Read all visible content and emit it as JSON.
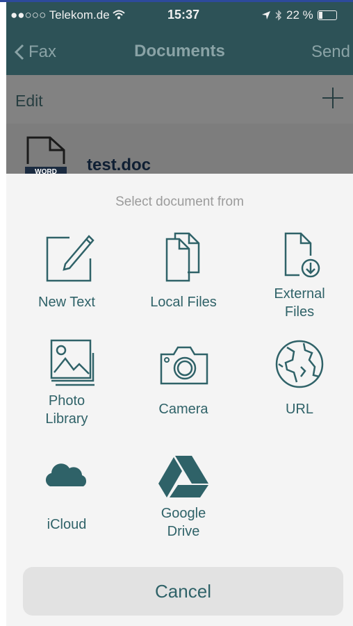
{
  "status": {
    "carrier": "●●○○○ Telekom.de",
    "time": "15:37",
    "battery": "22 %"
  },
  "nav": {
    "back_label": "Fax",
    "title": "Documents",
    "send_label": "Send"
  },
  "toolbar": {
    "edit_label": "Edit"
  },
  "document": {
    "name": "test.doc",
    "badge": "WORD"
  },
  "sheet": {
    "title": "Select document from",
    "options": [
      {
        "label": "New Text",
        "icon": "edit-note-icon"
      },
      {
        "label": "Local Files",
        "icon": "files-icon"
      },
      {
        "label": "External\nFiles",
        "icon": "download-file-icon"
      },
      {
        "label": "Photo\nLibrary",
        "icon": "photo-library-icon"
      },
      {
        "label": "Camera",
        "icon": "camera-icon"
      },
      {
        "label": "URL",
        "icon": "globe-icon"
      },
      {
        "label": "iCloud",
        "icon": "cloud-icon"
      },
      {
        "label": "Google\nDrive",
        "icon": "google-drive-icon"
      }
    ],
    "cancel_label": "Cancel"
  },
  "colors": {
    "accent": "#2f6268",
    "header": "#2d5257",
    "sheet_bg": "#f4f4f4"
  }
}
